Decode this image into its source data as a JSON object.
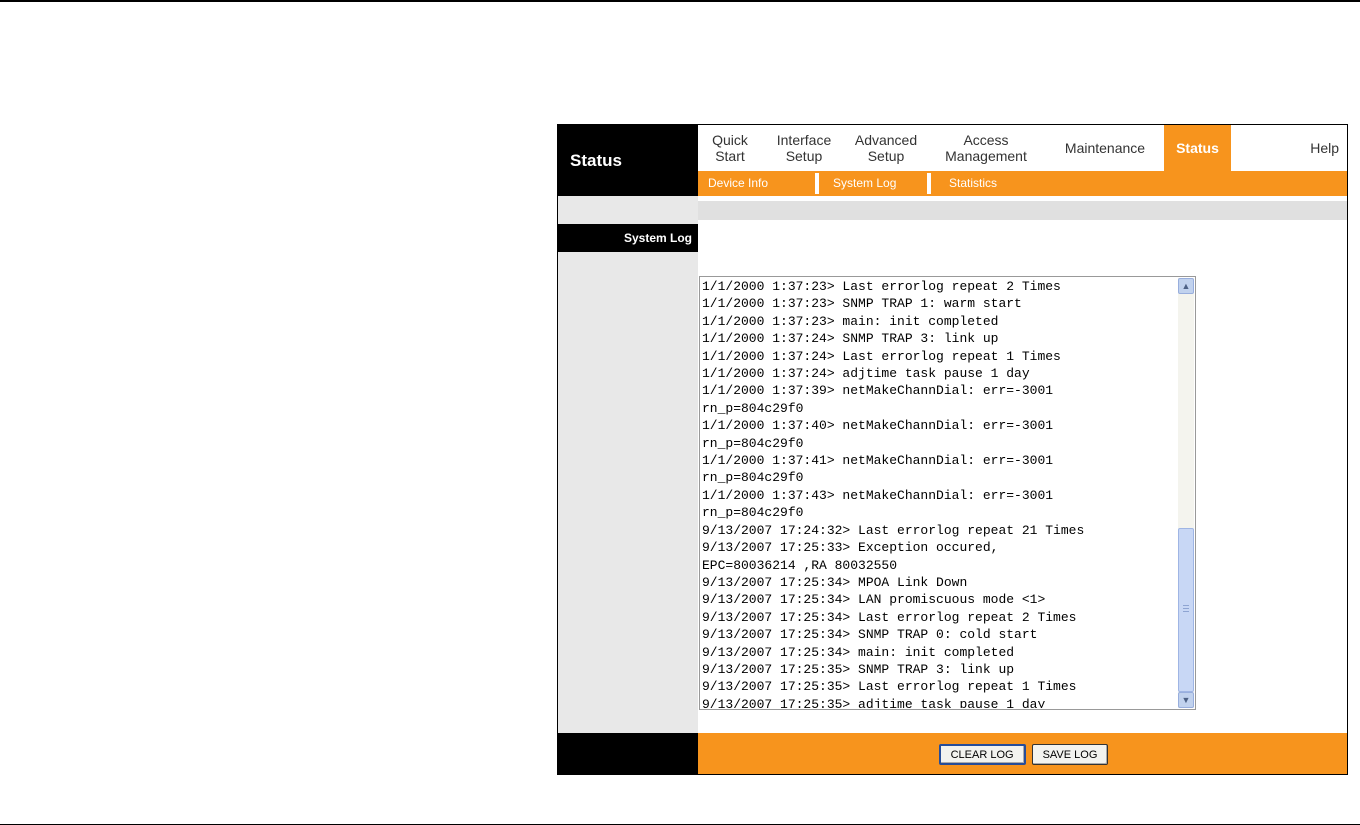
{
  "brand": "Status",
  "nav": {
    "items": [
      {
        "label": "Quick\nStart"
      },
      {
        "label": "Interface\nSetup"
      },
      {
        "label": "Advanced\nSetup"
      },
      {
        "label": "Access\nManagement"
      },
      {
        "label": "Maintenance"
      },
      {
        "label": "Status",
        "active": true
      },
      {
        "label": "Help"
      }
    ]
  },
  "subnav": {
    "items": [
      "Device Info",
      "System Log",
      "Statistics"
    ]
  },
  "section": {
    "label": "System Log"
  },
  "log": {
    "lines": [
      "1/1/2000 1:37:23> Last errorlog repeat 2 Times",
      "1/1/2000 1:37:23> SNMP TRAP 1: warm start",
      "1/1/2000 1:37:23> main: init completed",
      "1/1/2000 1:37:24> SNMP TRAP 3: link up",
      "1/1/2000 1:37:24> Last errorlog repeat 1 Times",
      "1/1/2000 1:37:24> adjtime task pause 1 day",
      "1/1/2000 1:37:39> netMakeChannDial: err=-3001",
      "rn_p=804c29f0",
      "1/1/2000 1:37:40> netMakeChannDial: err=-3001",
      "rn_p=804c29f0",
      "1/1/2000 1:37:41> netMakeChannDial: err=-3001",
      "rn_p=804c29f0",
      "1/1/2000 1:37:43> netMakeChannDial: err=-3001",
      "rn_p=804c29f0",
      "9/13/2007 17:24:32> Last errorlog repeat 21 Times",
      "9/13/2007 17:25:33> Exception occured,",
      "EPC=80036214 ,RA 80032550",
      "9/13/2007 17:25:34> MPOA Link Down",
      "9/13/2007 17:25:34> LAN promiscuous mode <1>",
      "9/13/2007 17:25:34> Last errorlog repeat 2 Times",
      "9/13/2007 17:25:34> SNMP TRAP 0: cold start",
      "9/13/2007 17:25:34> main: init completed",
      "9/13/2007 17:25:35> SNMP TRAP 3: link up",
      "9/13/2007 17:25:35> Last errorlog repeat 1 Times",
      "9/13/2007 17:25:35> adjtime task pause 1 day"
    ]
  },
  "buttons": {
    "clear_label": "CLEAR LOG",
    "save_label": "SAVE LOG"
  },
  "colors": {
    "accent": "#f7941d",
    "dark": "#000000",
    "panel": "#e8e8e8"
  },
  "icons": {
    "scroll_up": "up-arrow-icon",
    "scroll_down": "down-arrow-icon"
  }
}
